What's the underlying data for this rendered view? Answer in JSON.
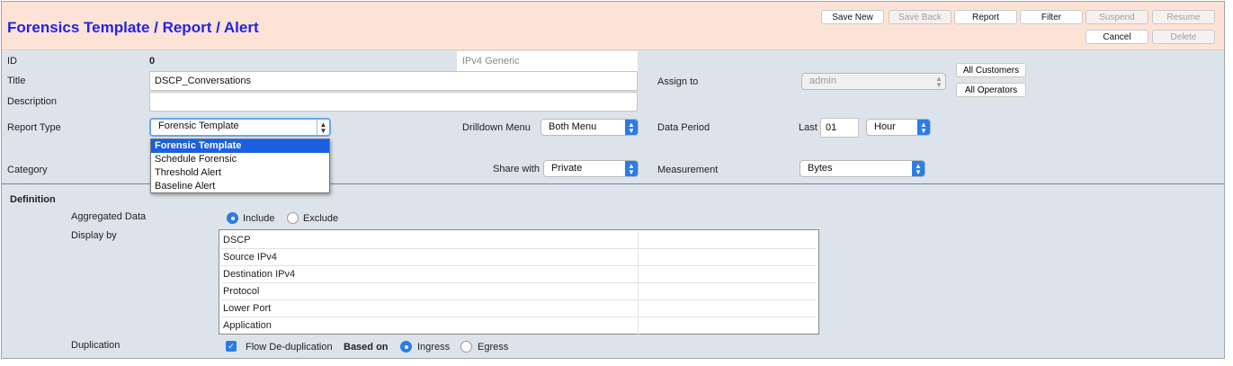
{
  "header": {
    "title": "Forensics Template / Report / Alert",
    "buttons": {
      "save_new": "Save New",
      "save_back": "Save Back",
      "report": "Report",
      "filter": "Filter",
      "suspend": "Suspend",
      "resume": "Resume",
      "cancel": "Cancel",
      "delete": "Delete"
    }
  },
  "form": {
    "id_label": "ID",
    "id_value": "0",
    "type_value": "IPv4 Generic",
    "title_label": "Title",
    "title_value": "DSCP_Conversations",
    "description_label": "Description",
    "description_value": "",
    "report_type_label": "Report Type",
    "report_type_value": "Forensic Template",
    "report_type_options": [
      "Forensic Template",
      "Schedule Forensic",
      "Threshold Alert",
      "Baseline Alert"
    ],
    "category_label": "Category",
    "assign_label": "Assign to",
    "assign_value": "admin",
    "all_customers": "All Customers",
    "all_operators": "All Operators",
    "drilldown_label": "Drilldown Menu",
    "drilldown_value": "Both Menu",
    "data_period_label": "Data Period",
    "last_label": "Last",
    "last_value": "01",
    "period_unit": "Hour",
    "share_label": "Share with",
    "share_value": "Private",
    "measurement_label": "Measurement",
    "measurement_value": "Bytes"
  },
  "definition": {
    "heading": "Definition",
    "aggregated_label": "Aggregated Data",
    "include_label": "Include",
    "exclude_label": "Exclude",
    "display_by_label": "Display by",
    "display_rows": [
      "DSCP",
      "Source IPv4",
      "Destination IPv4",
      "Protocol",
      "Lower Port",
      "Application"
    ],
    "duplication_label": "Duplication",
    "flow_dedup_label": "Flow De-duplication",
    "based_on_label": "Based on",
    "ingress_label": "Ingress",
    "egress_label": "Egress"
  },
  "colors": {
    "title": "#2323e6",
    "header_bg": "#fde3d6",
    "accent": "#2a7ce8",
    "panel_bg": "#dde3ea"
  }
}
